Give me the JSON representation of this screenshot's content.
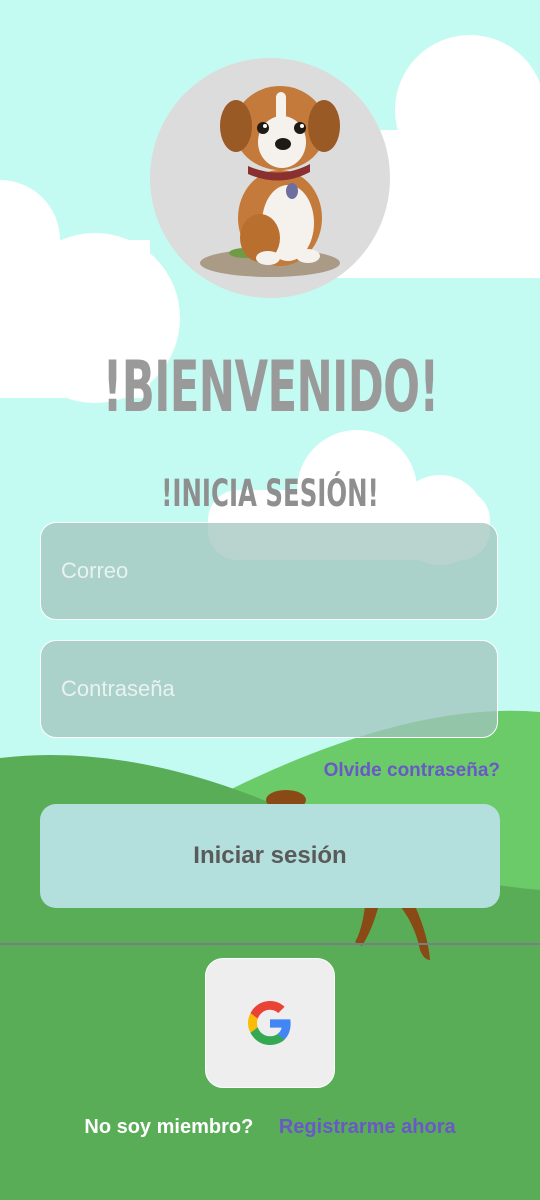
{
  "header": {
    "title": "!BIENVENIDO!",
    "subtitle": "!INICIA SESIÓN!"
  },
  "form": {
    "email_placeholder": "Correo",
    "password_placeholder": "Contraseña",
    "forgot_label": "Olvide contraseña?",
    "login_label": "Iniciar sesión"
  },
  "social": {
    "google_icon": "google-icon"
  },
  "footer": {
    "not_member": "No soy miembro?",
    "register_label": "Registrarme ahora"
  },
  "colors": {
    "sky": "#c3fbf3",
    "grass": "#5aad57",
    "light_grass": "#6acb68",
    "accent": "#6a58c8",
    "title_gray": "#9a9a9a"
  }
}
